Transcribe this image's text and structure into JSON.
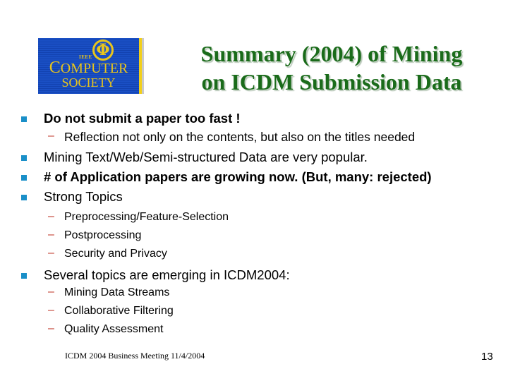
{
  "logo": {
    "symbol": "Φ",
    "ieee": "IEEE",
    "line1_initial": "C",
    "line1_rest": "OMPUTER",
    "line2": "SOCIETY"
  },
  "title": {
    "line1": "Summary (2004) of Mining",
    "line2": "on  ICDM Submission Data"
  },
  "bullets": [
    {
      "text": "Do not submit a paper too fast !",
      "bold": true,
      "sub": [
        "Reflection not only on the contents, but also on the titles needed"
      ]
    },
    {
      "text": "Mining Text/Web/Semi-structured Data are very popular.",
      "bold": false,
      "sub": []
    },
    {
      "text": "# of Application papers are growing now.  (But, many: rejected)",
      "bold": true,
      "sub": []
    },
    {
      "text": "Strong Topics",
      "bold": false,
      "sub": [
        "Preprocessing/Feature-Selection",
        "Postprocessing",
        "Security and Privacy"
      ]
    },
    {
      "text": "Several topics are emerging in ICDM2004:",
      "bold": false,
      "sub": [
        "Mining Data Streams",
        "Collaborative Filtering",
        "Quality Assessment"
      ]
    }
  ],
  "sub_marker": "–",
  "footer": {
    "text": "ICDM 2004 Business Meeting 11/4/2004",
    "page_number": "13"
  },
  "colors": {
    "title": "#1a6b1a",
    "bullet": "#1a8fc8",
    "dash": "#c0392b",
    "logo_blue": "#1a4fc4",
    "logo_gold": "#e8c51c"
  }
}
